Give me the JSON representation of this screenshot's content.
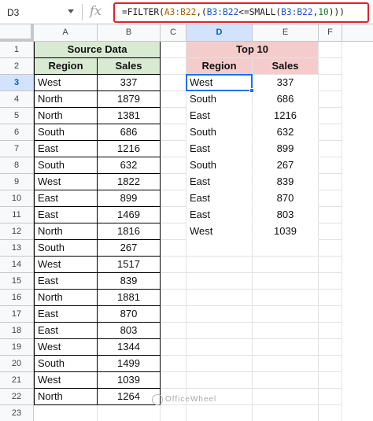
{
  "formula_bar": {
    "name_box": "D3",
    "fx_label": "fx",
    "formula_parts": {
      "p1": "=FILTER(",
      "r1": "A3:B22",
      "p2": ",(",
      "r2": "B3:B22",
      "p3": "<=SMALL(",
      "r3": "B3:B22",
      "p4": ",",
      "n1": "10",
      "p5": ")))"
    }
  },
  "columns": [
    "A",
    "B",
    "C",
    "D",
    "E",
    "F"
  ],
  "rows": [
    "1",
    "2",
    "3",
    "4",
    "5",
    "6",
    "7",
    "8",
    "9",
    "10",
    "11",
    "12",
    "13",
    "14",
    "15",
    "16",
    "17",
    "18",
    "19",
    "20",
    "21",
    "22",
    "23"
  ],
  "source": {
    "title": "Source Data",
    "headers": [
      "Region",
      "Sales"
    ],
    "rows": [
      [
        "West",
        "337"
      ],
      [
        "North",
        "1879"
      ],
      [
        "North",
        "1381"
      ],
      [
        "South",
        "686"
      ],
      [
        "East",
        "1216"
      ],
      [
        "South",
        "632"
      ],
      [
        "West",
        "1822"
      ],
      [
        "East",
        "899"
      ],
      [
        "East",
        "1469"
      ],
      [
        "North",
        "1816"
      ],
      [
        "South",
        "267"
      ],
      [
        "West",
        "1517"
      ],
      [
        "East",
        "839"
      ],
      [
        "North",
        "1881"
      ],
      [
        "East",
        "870"
      ],
      [
        "East",
        "803"
      ],
      [
        "West",
        "1344"
      ],
      [
        "South",
        "1499"
      ],
      [
        "West",
        "1039"
      ],
      [
        "North",
        "1264"
      ]
    ]
  },
  "result": {
    "title": "Top 10",
    "headers": [
      "Region",
      "Sales"
    ],
    "rows": [
      [
        "West",
        "337"
      ],
      [
        "South",
        "686"
      ],
      [
        "East",
        "1216"
      ],
      [
        "South",
        "632"
      ],
      [
        "East",
        "899"
      ],
      [
        "South",
        "267"
      ],
      [
        "East",
        "839"
      ],
      [
        "East",
        "870"
      ],
      [
        "East",
        "803"
      ],
      [
        "West",
        "1039"
      ]
    ]
  },
  "watermark": "OfficeWheel",
  "colors": {
    "source_fill": "#d9ead3",
    "result_fill": "#f4cccc",
    "highlight": "#e0212e",
    "selection": "#1a73e8"
  }
}
